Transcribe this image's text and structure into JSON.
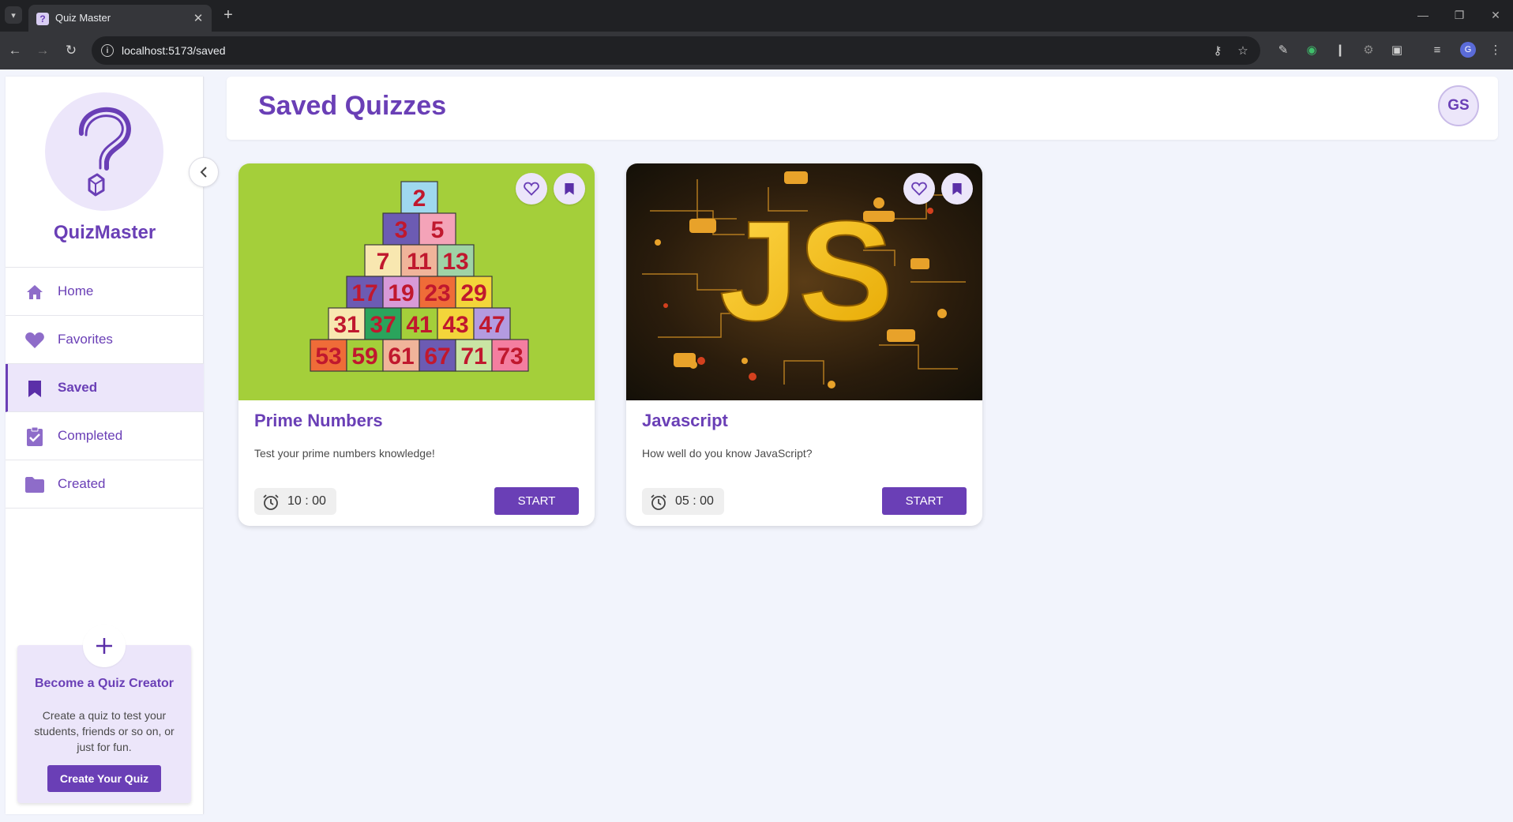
{
  "browser": {
    "tab_title": "Quiz Master",
    "url": "localhost:5173/saved",
    "profile_initial": "G"
  },
  "sidebar": {
    "brand": "QuizMaster",
    "items": [
      {
        "label": "Home",
        "icon": "home-icon"
      },
      {
        "label": "Favorites",
        "icon": "heart-icon"
      },
      {
        "label": "Saved",
        "icon": "bookmark-icon",
        "active": true
      },
      {
        "label": "Completed",
        "icon": "clipboard-check-icon"
      },
      {
        "label": "Created",
        "icon": "folder-icon"
      }
    ],
    "creator": {
      "title": "Become a Quiz Creator",
      "description": "Create a quiz to test your students, friends or so on, or just for fun.",
      "button": "Create Your Quiz"
    }
  },
  "header": {
    "title": "Saved Quizzes",
    "avatar_initials": "GS"
  },
  "quizzes": [
    {
      "title": "Prime Numbers",
      "description": "Test your prime numbers knowledge!",
      "timer": "10 : 00",
      "start_label": "START",
      "image_numbers": [
        "2",
        "3",
        "5",
        "7",
        "11",
        "13",
        "17",
        "19",
        "23",
        "29",
        "31",
        "37",
        "41",
        "43",
        "47",
        "53",
        "59",
        "61",
        "67",
        "71",
        "73"
      ]
    },
    {
      "title": "Javascript",
      "description": "How well do you know JavaScript?",
      "timer": "05 : 00",
      "start_label": "START",
      "image_text": "JS"
    }
  ],
  "colors": {
    "accent": "#6a3fb6",
    "accent_light": "#ece6fa",
    "page_bg": "#f2f4fc",
    "prime_bg": "#a4cf3a",
    "js_yellow": "#f5c518"
  }
}
